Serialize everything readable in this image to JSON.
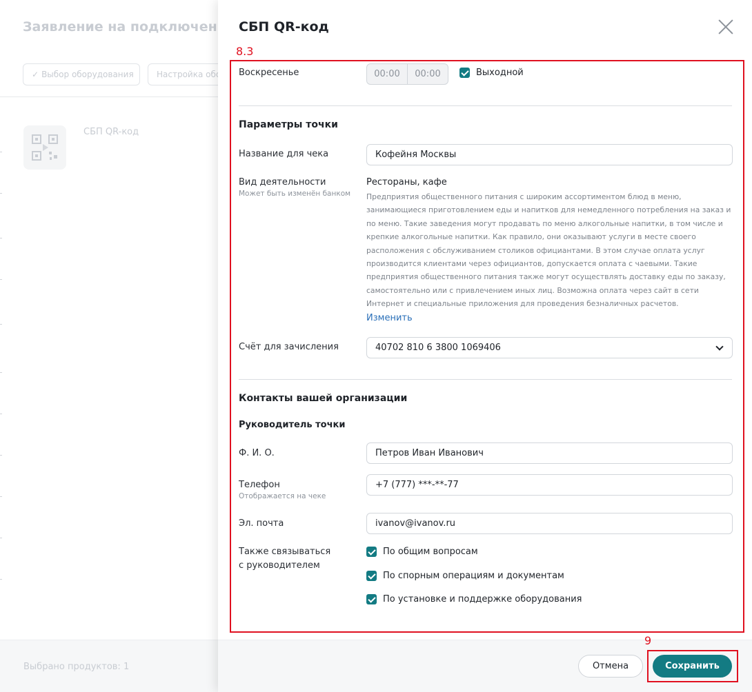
{
  "background": {
    "title": "Заявление на подключение п",
    "steps": [
      "Выбор оборудования",
      "Настройка обору"
    ],
    "product_name": "СБП QR-код",
    "selected_products": "Выбрано продуктов: 1"
  },
  "panel": {
    "title": "СБП QR-код",
    "annotations": {
      "section": "8.3",
      "save": "9"
    },
    "schedule": {
      "day_label": "Воскресенье",
      "time_from": "00:00",
      "time_to": "00:00",
      "day_off_label": "Выходной",
      "day_off_checked": true
    },
    "point_params": {
      "title": "Параметры точки",
      "receipt_name_label": "Название для чека",
      "receipt_name_value": "Кофейня Москвы",
      "activity_label": "Вид деятельности",
      "activity_hint": "Может быть изменён банком",
      "activity_value": "Рестораны, кафе",
      "activity_description": "Предприятия общественного питания с широким ассортиментом блюд в меню, занимающиеся приготовлением еды и напитков для немедленного потребления на заказ и по меню. Такие заведения могут продавать по меню алкогольные напитки, в том числе и крепкие алкогольные напитки. Как правило, они оказывают услуги в месте своего расположения с обслуживанием столиков официантами. В этом случае оплата услуг производится клиентами через официантов, допускается оплата с чаевыми. Такие предприятия общественного питания также могут осуществлять доставку еды по заказу, самостоятельно или с привлечением иных лиц. Возможна оплата через сайт в сети Интернет и специальные приложения для проведения безналичных расчетов.",
      "change_link": "Изменить",
      "account_label": "Счёт для зачисления",
      "account_value": "40702 810 6 3800 1069406"
    },
    "contacts": {
      "title": "Контакты вашей организации",
      "manager_title": "Руководитель точки",
      "fio_label": "Ф. И. О.",
      "fio_value": "Петров Иван Иванович",
      "phone_label": "Телефон",
      "phone_hint": "Отображается на чеке",
      "phone_value": "+7 (777) ***-**-77",
      "email_label": "Эл. почта",
      "email_value": "ivanov@ivanov.ru",
      "also_contact_label_1": "Также связываться",
      "also_contact_label_2": "с руководителем",
      "options": [
        {
          "label": "По общим вопросам",
          "checked": true
        },
        {
          "label": "По спорным операциям и документам",
          "checked": true
        },
        {
          "label": "По установке и поддержке оборудования",
          "checked": true
        }
      ]
    },
    "footer": {
      "cancel": "Отмена",
      "save": "Сохранить"
    }
  },
  "colors": {
    "accent": "#137b83",
    "annotation_red": "#e0101f",
    "link": "#2a6fb8"
  }
}
